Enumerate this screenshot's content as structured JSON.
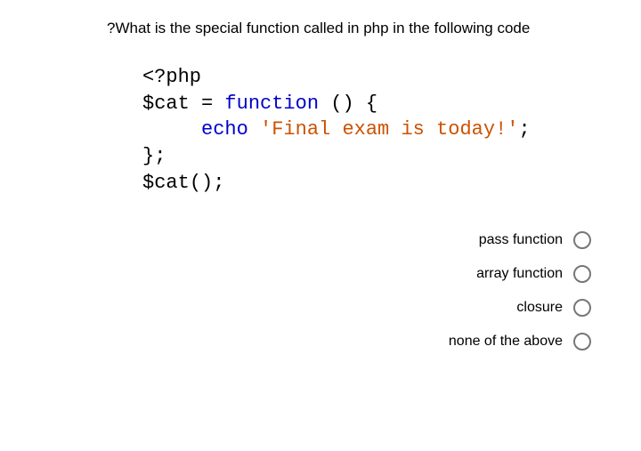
{
  "question": "?What is the special function called in php in the following code",
  "code": {
    "line1_open": "<?php",
    "line2_var": "$cat",
    "line2_eq": " = ",
    "line2_kw": "function",
    "line2_rest": " () {",
    "line3_indent": "     ",
    "line3_echo": "echo",
    "line3_space": " ",
    "line3_str": "'Final exam is today!'",
    "line3_semi": ";",
    "line4": "};",
    "line5_var": "$cat",
    "line5_rest": "();"
  },
  "options": [
    {
      "label": "pass function"
    },
    {
      "label": "array function"
    },
    {
      "label": "closure"
    },
    {
      "label": "none of the above"
    }
  ]
}
